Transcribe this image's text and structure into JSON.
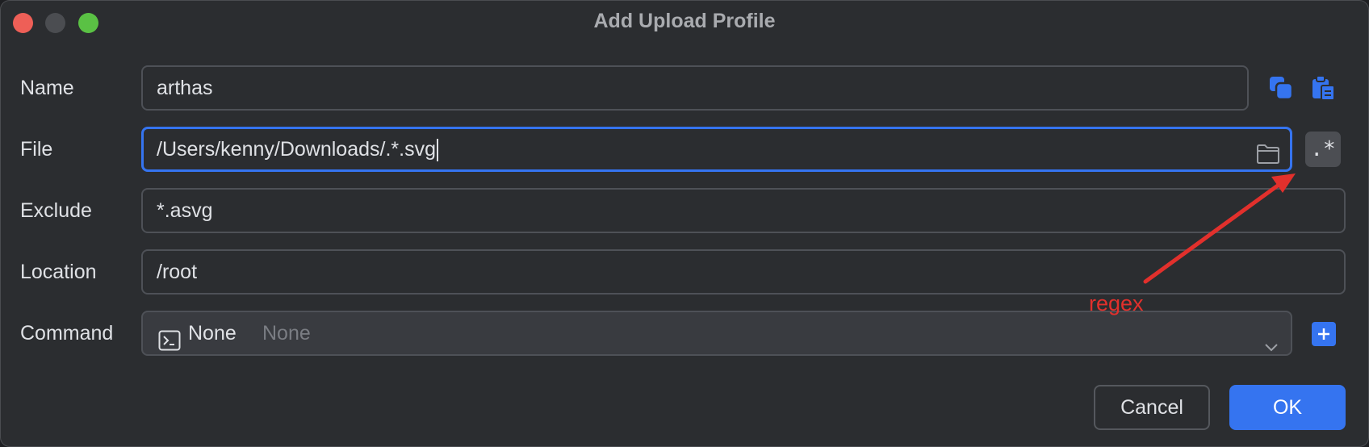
{
  "window": {
    "title": "Add Upload Profile"
  },
  "form": {
    "name": {
      "label": "Name",
      "value": "arthas"
    },
    "file": {
      "label": "File",
      "value": "/Users/kenny/Downloads/.*.svg"
    },
    "exclude": {
      "label": "Exclude",
      "value": "*.asvg"
    },
    "location": {
      "label": "Location",
      "value": "/root"
    },
    "command": {
      "label": "Command",
      "value": "None",
      "placeholder": "None"
    }
  },
  "regex_toggle": {
    "label": ".*"
  },
  "annotation": {
    "text": "regex",
    "color": "#e2302c"
  },
  "buttons": {
    "cancel": "Cancel",
    "ok": "OK"
  },
  "colors": {
    "accent": "#3574f0",
    "background": "#2b2d30"
  },
  "icons": [
    "copy-icon",
    "paste-icon",
    "folder-icon",
    "terminal-icon",
    "chevron-down-icon",
    "plus-icon"
  ]
}
